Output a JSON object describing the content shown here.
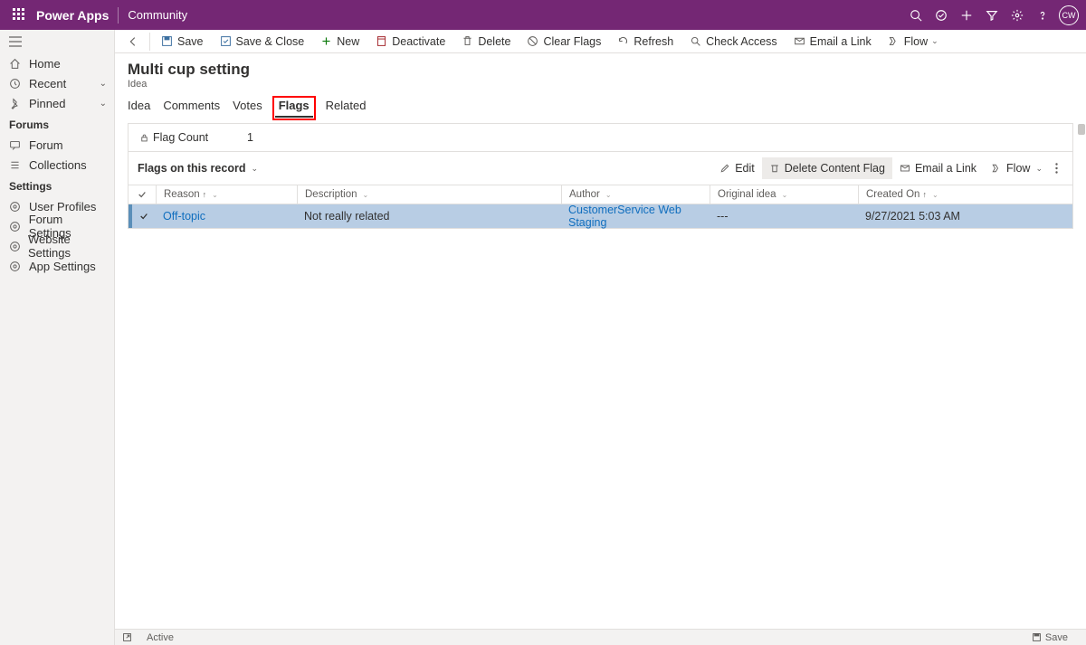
{
  "topbar": {
    "brand": "Power Apps",
    "area": "Community",
    "avatar": "CW"
  },
  "nav": {
    "home": "Home",
    "recent": "Recent",
    "pinned": "Pinned",
    "section_forums": "Forums",
    "forum": "Forum",
    "collections": "Collections",
    "section_settings": "Settings",
    "user_profiles": "User Profiles",
    "forum_settings": "Forum Settings",
    "website_settings": "Website Settings",
    "app_settings": "App Settings"
  },
  "cmd": {
    "save": "Save",
    "save_close": "Save & Close",
    "new": "New",
    "deactivate": "Deactivate",
    "delete": "Delete",
    "clear_flags": "Clear Flags",
    "refresh": "Refresh",
    "check_access": "Check Access",
    "email_link": "Email a Link",
    "flow": "Flow"
  },
  "page": {
    "title": "Multi cup setting",
    "entity": "Idea"
  },
  "tabs": {
    "idea": "Idea",
    "comments": "Comments",
    "votes": "Votes",
    "flags": "Flags",
    "related": "Related"
  },
  "flag_count": {
    "label": "Flag Count",
    "value": "1"
  },
  "subgrid": {
    "title": "Flags on this record",
    "edit": "Edit",
    "delete_flag": "Delete Content Flag",
    "email_link": "Email a Link",
    "flow": "Flow",
    "cols": {
      "reason": "Reason",
      "description": "Description",
      "author": "Author",
      "original": "Original idea",
      "created": "Created On"
    },
    "row": {
      "reason": "Off-topic",
      "description": "Not really related",
      "author": "CustomerService Web Staging",
      "original": "---",
      "created": "9/27/2021 5:03 AM"
    }
  },
  "status": {
    "active": "Active",
    "save": "Save"
  }
}
